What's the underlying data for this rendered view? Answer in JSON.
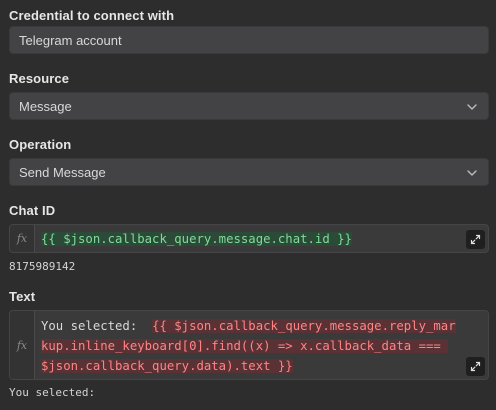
{
  "credential": {
    "label": "Credential to connect with",
    "value": "Telegram account"
  },
  "resource": {
    "label": "Resource",
    "value": "Message",
    "icon": "chevron-down-icon"
  },
  "operation": {
    "label": "Operation",
    "value": "Send Message",
    "icon": "chevron-down-icon"
  },
  "chat_id": {
    "label": "Chat ID",
    "fx": "fx",
    "expression": "{{ $json.callback_query.message.chat.id }}",
    "result": "8175989142"
  },
  "text": {
    "label": "Text",
    "fx": "fx",
    "prefix": "You selected:  ",
    "expression": "{{ $json.callback_query.message.reply_markup.inline_keyboard[0].find((x) => x.callback_data === $json.callback_query.data).text }}",
    "result": "You selected:"
  },
  "colors": {
    "background": "#2d2d2e",
    "field": "#434345",
    "valid_expression": "#7fdc98",
    "invalid_expression": "#ff8585"
  }
}
